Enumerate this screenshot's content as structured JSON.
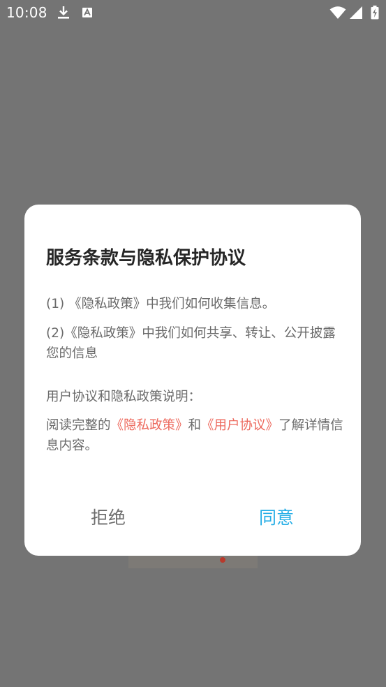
{
  "status_bar": {
    "time": "10:08",
    "icons": [
      "download-icon",
      "app-a-icon",
      "wifi-icon",
      "signal-icon",
      "battery-charging-icon"
    ]
  },
  "dialog": {
    "title": "服务条款与隐私保护协议",
    "item1": "(1) 《隐私政策》中我们如何收集信息。",
    "item2": "(2)《隐私政策》中我们如何共享、转让、公开披露您的信息",
    "section_heading": "用户协议和隐私政策说明：",
    "read_prefix": "阅读完整的",
    "privacy_link": "《隐私政策》",
    "conjunction": "和",
    "user_agreement_link": "《用户协议》",
    "read_suffix": "了解详情信息内容。",
    "reject_label": "拒绝",
    "agree_label": "同意"
  },
  "colors": {
    "overlay": "#747474",
    "link": "#ed6a5e",
    "agree": "#27aee6",
    "reject": "#6d6d6d",
    "title": "#262626",
    "body_text": "#6a6a6a"
  }
}
